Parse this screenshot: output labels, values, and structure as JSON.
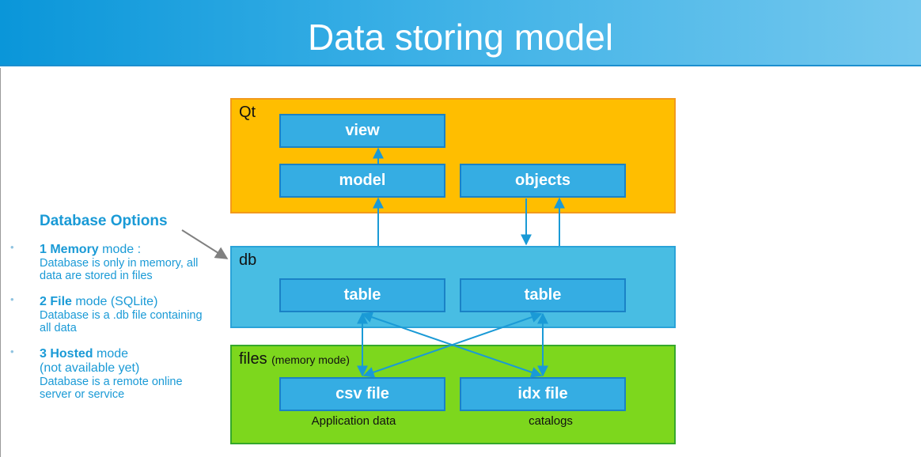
{
  "header": {
    "title": "Data storing model"
  },
  "layers": {
    "qt": {
      "label": "Qt"
    },
    "db": {
      "label": "db"
    },
    "files": {
      "label": "files",
      "note": "(memory mode)"
    }
  },
  "nodes": {
    "view": "view",
    "model": "model",
    "objects": "objects",
    "table_left": "table",
    "table_right": "table",
    "csv": "csv file",
    "idx": "idx file"
  },
  "captions": {
    "csv": "Application data",
    "idx": "catalogs"
  },
  "options": {
    "title": "Database Options",
    "items": [
      {
        "bullet": "•",
        "number_name": "1 Memory",
        "mode": " mode :",
        "line2": "",
        "description": "Database is only in memory, all data are stored in files"
      },
      {
        "bullet": "•",
        "number_name": "2 File",
        "mode": " mode (SQLite)",
        "line2": "",
        "description": "Database is a .db file containing all data"
      },
      {
        "bullet": "•",
        "number_name": "3 Hosted",
        "mode": " mode",
        "line2": "(not available yet)",
        "description": "Database is a remote online server or service"
      }
    ]
  },
  "colors": {
    "header_blue": "#0a96d9",
    "qt_orange": "#ffbe00",
    "db_blue": "#48bde3",
    "files_green": "#7dd71d",
    "node_blue": "#35ade3",
    "connector_blue": "#1a9ad6",
    "pointer_gray": "#808080",
    "options_text": "#1a9ad6"
  }
}
